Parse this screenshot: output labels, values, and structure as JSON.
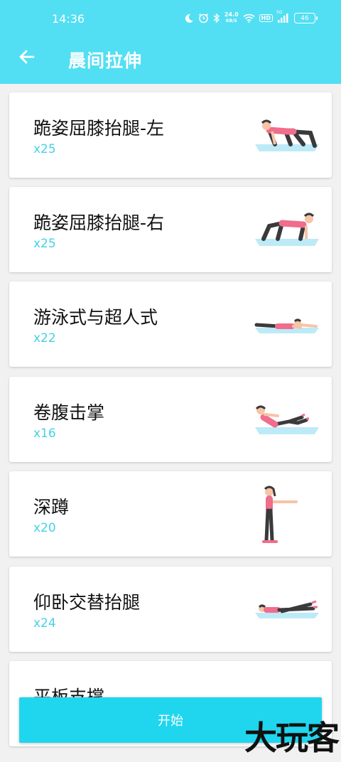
{
  "status_bar": {
    "time": "14:36",
    "net_speed_value": "24.0",
    "net_speed_unit": "KB/S",
    "hd": "HD",
    "signal_label": "5G",
    "battery": "46"
  },
  "app_bar": {
    "title": "晨间拉伸",
    "back_icon": "arrow-left-icon"
  },
  "exercises": [
    {
      "name": "跪姿屈膝抬腿-左",
      "reps": "x25",
      "pose": "kneeling-leg-raise-left"
    },
    {
      "name": "跪姿屈膝抬腿-右",
      "reps": "x25",
      "pose": "kneeling-leg-raise-right"
    },
    {
      "name": "游泳式与超人式",
      "reps": "x22",
      "pose": "swimmer-superman"
    },
    {
      "name": "卷腹击掌",
      "reps": "x16",
      "pose": "crunch-clap"
    },
    {
      "name": "深蹲",
      "reps": "x20",
      "pose": "squat"
    },
    {
      "name": "仰卧交替抬腿",
      "reps": "x24",
      "pose": "supine-alternate-leg-raise"
    },
    {
      "name": "平板支撑",
      "reps": "",
      "pose": "plank"
    }
  ],
  "start_button": {
    "label": "开始"
  },
  "watermark": "大玩客",
  "colors": {
    "accent": "#52dff3",
    "button": "#1fd6ee",
    "reps_text": "#45d1e6",
    "skin": "#f6c4a6",
    "top": "#f06d8b",
    "pants": "#3a3a3c",
    "mat": "#bdeaf7"
  }
}
